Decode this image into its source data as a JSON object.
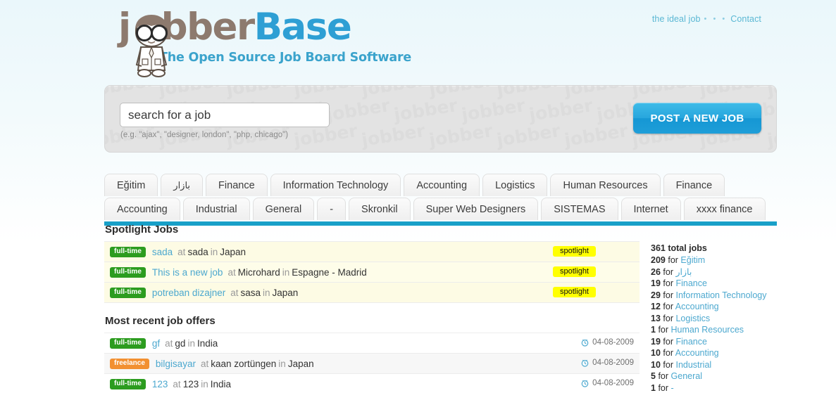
{
  "topnav": {
    "ideal_job": "the ideal job",
    "dots": "• • •",
    "contact": "Contact"
  },
  "logo": {
    "text_j": "j",
    "text_bber": "bber",
    "text_base": "Base",
    "tagline": "The Open Source Job Board Software"
  },
  "search": {
    "placeholder": "search for a job",
    "value": "",
    "hint": "(e.g. \"ajax\", \"designer, london\", \"php, chicago\")",
    "post_button": "POST A NEW JOB"
  },
  "tabs": {
    "row1": [
      "Eğitim",
      "بازار",
      "Finance",
      "Information Technology",
      "Accounting",
      "Logistics",
      "Human Resources",
      "Finance"
    ],
    "row2": [
      "Accounting",
      "Industrial",
      "General",
      "-",
      "Skronkil",
      "Super Web Designers",
      "SISTEMAS",
      "Internet",
      "xxxx finance"
    ]
  },
  "spotlight": {
    "title": "Spotlight Jobs",
    "badge_label": "spotlight",
    "at_word": "at",
    "in_word": "in",
    "jobs": [
      {
        "type": "full-time",
        "title": "sada",
        "company": "sada",
        "location": "Japan"
      },
      {
        "type": "full-time",
        "title": "This is a new job",
        "company": "Microhard",
        "location": "Espagne - Madrid"
      },
      {
        "type": "full-time",
        "title": "potreban dizajner",
        "company": "sasa",
        "location": "Japan"
      }
    ]
  },
  "recent": {
    "title": "Most recent job offers",
    "at_word": "at",
    "in_word": "in",
    "jobs": [
      {
        "type": "full-time",
        "title": "gf",
        "company": "gd",
        "location": "India",
        "date": "04-08-2009"
      },
      {
        "type": "freelance",
        "title": "bilgisayar",
        "company": "kaan zortüngen",
        "location": "Japan",
        "date": "04-08-2009"
      },
      {
        "type": "full-time",
        "title": "123",
        "company": "123",
        "location": "India",
        "date": "04-08-2009"
      }
    ]
  },
  "sidebar": {
    "total": "361 total jobs",
    "for_word": "for",
    "stats": [
      {
        "count": "209",
        "label": "Eğitim"
      },
      {
        "count": "26",
        "label": "بازار"
      },
      {
        "count": "19",
        "label": "Finance"
      },
      {
        "count": "29",
        "label": "Information Technology"
      },
      {
        "count": "12",
        "label": "Accounting"
      },
      {
        "count": "13",
        "label": "Logistics"
      },
      {
        "count": "1",
        "label": "Human Resources"
      },
      {
        "count": "19",
        "label": "Finance"
      },
      {
        "count": "10",
        "label": "Accounting"
      },
      {
        "count": "10",
        "label": "Industrial"
      },
      {
        "count": "5",
        "label": "General"
      },
      {
        "count": "1",
        "label": "-"
      }
    ]
  },
  "watermark_word": "jobber",
  "colors": {
    "accent_blue": "#18a0c8",
    "link_blue": "#4ca8cf",
    "logo_brown": "#8d7a6e",
    "fulltime_green": "#2c9c1f",
    "freelance_orange": "#f29031",
    "spotlight_yellow": "#ffff00"
  }
}
